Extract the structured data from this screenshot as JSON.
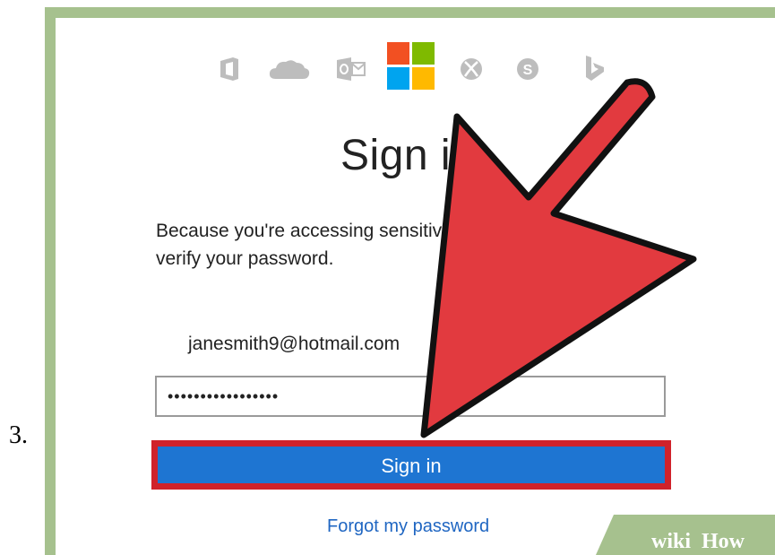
{
  "step": {
    "number": "3."
  },
  "signin": {
    "title": "Sign in",
    "message_line1": "Because you're accessing sensitive info, you need to",
    "message_line2": "verify your password.",
    "email": "janesmith9@hotmail.com",
    "password_value": "•••••••••••••••••",
    "button_label": "Sign in",
    "forgot_link": "Forgot my password"
  },
  "product_icons": [
    "office-icon",
    "onedrive-icon",
    "outlook-icon",
    "microsoft-logo-icon",
    "xbox-icon",
    "skype-icon",
    "bing-icon"
  ],
  "watermark": {
    "text_wiki": "wiki",
    "text_how": "How"
  },
  "colors": {
    "frame": "#a6c18e",
    "button": "#1e75d2",
    "highlight": "#d0222a",
    "arrow": "#e23a3f",
    "link": "#1f66c2",
    "ms_red": "#f25022",
    "ms_green": "#7fba00",
    "ms_blue": "#00a4ef",
    "ms_yellow": "#ffb900"
  }
}
